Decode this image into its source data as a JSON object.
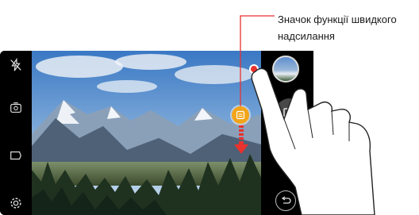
{
  "callout": {
    "line1": "Значок функції швидкого",
    "line2": "надсилання"
  },
  "left_bar": {
    "icons": [
      "flash-off-icon",
      "switch-camera-icon",
      "mode-icon",
      "settings-icon"
    ]
  },
  "right_bar": {
    "icons": [
      "gallery-thumbnail",
      "video-record-icon",
      "back-icon"
    ]
  },
  "colors": {
    "quick_share": "#f2a51a",
    "touch_dot": "#e8322e",
    "arrow": "#e8322e",
    "callout_line": "#e8322e"
  }
}
